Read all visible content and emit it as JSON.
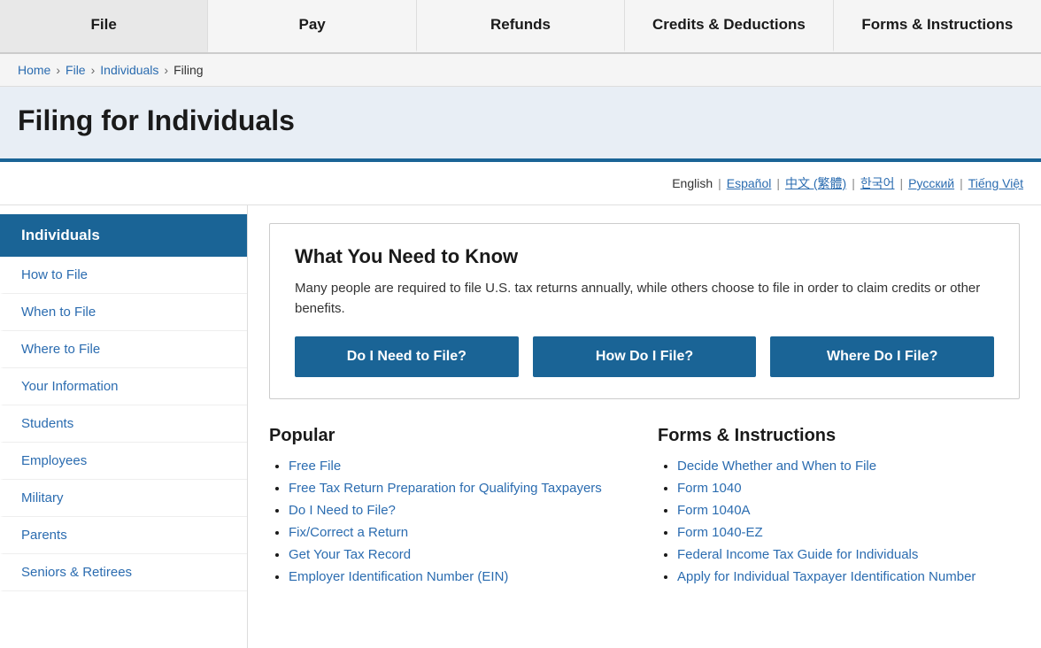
{
  "nav": {
    "items": [
      {
        "label": "File",
        "id": "nav-file"
      },
      {
        "label": "Pay",
        "id": "nav-pay"
      },
      {
        "label": "Refunds",
        "id": "nav-refunds"
      },
      {
        "label": "Credits & Deductions",
        "id": "nav-credits"
      },
      {
        "label": "Forms & Instructions",
        "id": "nav-forms"
      }
    ]
  },
  "breadcrumb": {
    "items": [
      {
        "label": "Home",
        "href": "#"
      },
      {
        "label": "File",
        "href": "#"
      },
      {
        "label": "Individuals",
        "href": "#"
      },
      {
        "label": "Filing",
        "href": null
      }
    ]
  },
  "pageTitle": "Filing for Individuals",
  "languages": [
    {
      "label": "English",
      "current": true
    },
    {
      "label": "Español",
      "current": false
    },
    {
      "label": "中文 (繁體)",
      "current": false
    },
    {
      "label": "한국어",
      "current": false
    },
    {
      "label": "Русский",
      "current": false
    },
    {
      "label": "Tiếng Việt",
      "current": false
    }
  ],
  "sidebar": {
    "header": "Individuals",
    "items": [
      {
        "label": "How to File"
      },
      {
        "label": "When to File"
      },
      {
        "label": "Where to File"
      },
      {
        "label": "Your Information"
      },
      {
        "label": "Students"
      },
      {
        "label": "Employees"
      },
      {
        "label": "Military"
      },
      {
        "label": "Parents"
      },
      {
        "label": "Seniors & Retirees"
      }
    ]
  },
  "infoBox": {
    "title": "What You Need to Know",
    "description": "Many people are required to file U.S. tax returns annually, while others choose to file in order to claim credits or other benefits.",
    "buttons": [
      {
        "label": "Do I Need to File?"
      },
      {
        "label": "How Do I File?"
      },
      {
        "label": "Where Do I File?"
      }
    ]
  },
  "popular": {
    "heading": "Popular",
    "links": [
      {
        "label": "Free File"
      },
      {
        "label": "Free Tax Return Preparation for Qualifying Taxpayers"
      },
      {
        "label": "Do I Need to File?"
      },
      {
        "label": "Fix/Correct a Return"
      },
      {
        "label": "Get Your Tax Record"
      },
      {
        "label": "Employer Identification Number (EIN)"
      }
    ]
  },
  "formsInstructions": {
    "heading": "Forms & Instructions",
    "links": [
      {
        "label": "Decide Whether and When to File"
      },
      {
        "label": "Form 1040"
      },
      {
        "label": "Form 1040A"
      },
      {
        "label": "Form 1040-EZ"
      },
      {
        "label": "Federal Income Tax Guide for Individuals"
      },
      {
        "label": "Apply for Individual Taxpayer Identification Number"
      }
    ]
  }
}
